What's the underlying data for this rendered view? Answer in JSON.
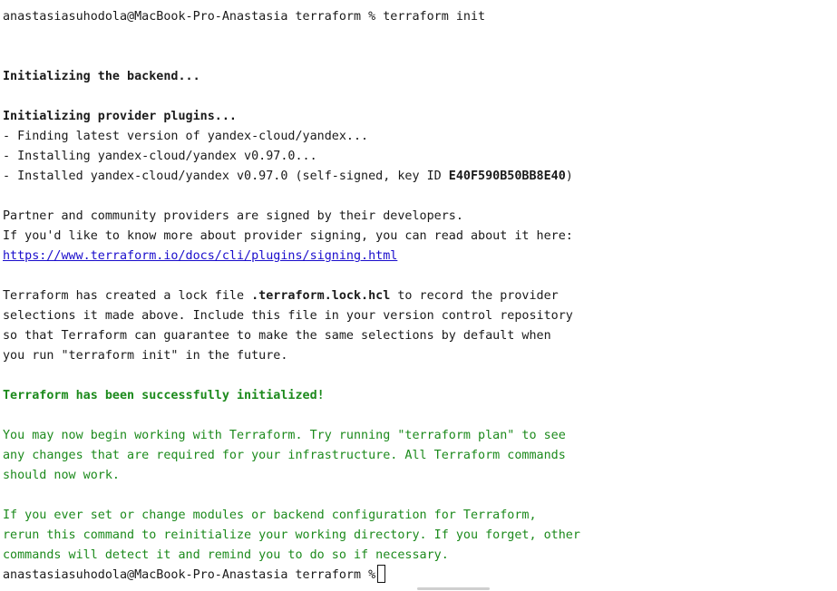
{
  "prompt": {
    "user_host": "anastasiasuhodola@MacBook-Pro-Anastasia",
    "dir": "terraform",
    "symbol": "%",
    "command": "terraform init"
  },
  "output": {
    "backend": "Initializing the backend...",
    "provider_plugins": "Initializing provider plugins...",
    "finding": "- Finding latest version of yandex-cloud/yandex...",
    "installing": "- Installing yandex-cloud/yandex v0.97.0...",
    "installed_prefix": "- Installed yandex-cloud/yandex v0.97.0 (self-signed, key ID ",
    "installed_key": "E40F590B50BB8E40",
    "installed_suffix": ")",
    "partner_line1": "Partner and community providers are signed by their developers.",
    "partner_line2": "If you'd like to know more about provider signing, you can read about it here:",
    "signing_link": "https://www.terraform.io/docs/cli/plugins/signing.html",
    "lock_line1_prefix": "Terraform has created a lock file ",
    "lock_file": ".terraform.lock.hcl",
    "lock_line1_suffix": " to record the provider",
    "lock_line2": "selections it made above. Include this file in your version control repository",
    "lock_line3": "so that Terraform can guarantee to make the same selections by default when",
    "lock_line4": "you run \"terraform init\" in the future.",
    "success": "Terraform has been successfully initialized!",
    "begin_line1": "You may now begin working with Terraform. Try running \"terraform plan\" to see",
    "begin_line2": "any changes that are required for your infrastructure. All Terraform commands",
    "begin_line3": "should now work.",
    "modules_line1": "If you ever set or change modules or backend configuration for Terraform,",
    "modules_line2": "rerun this command to reinitialize your working directory. If you forget, other",
    "modules_line3": "commands will detect it and remind you to do so if necessary."
  },
  "colors": {
    "success_green": "#1c8a1c",
    "link_blue": "#1a0dcc",
    "text": "#1a1a1a",
    "background": "#ffffff"
  }
}
